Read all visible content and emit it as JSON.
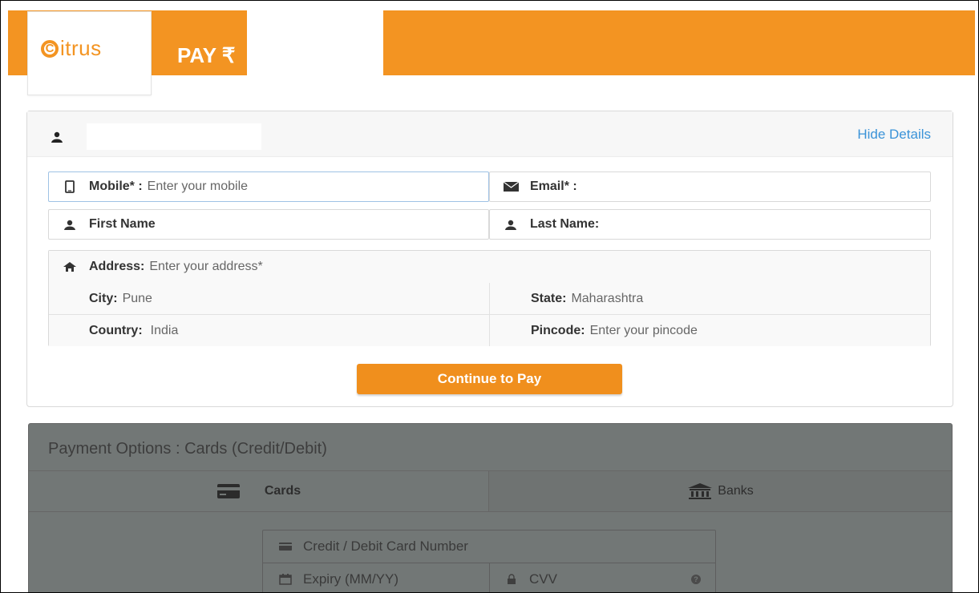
{
  "brand": {
    "logo_letter": "C",
    "logo_text": "itrus",
    "pay_label": "PAY ₹",
    "accent_color": "#f39422"
  },
  "customer": {
    "hide_details": "Hide Details",
    "mobile": {
      "label": "Mobile* :",
      "placeholder": "Enter your mobile"
    },
    "email": {
      "label": "Email* :"
    },
    "first_name": {
      "label": "First Name"
    },
    "last_name": {
      "label": "Last Name:"
    },
    "address": {
      "label": "Address:",
      "placeholder": "Enter your address*"
    },
    "city": {
      "label": "City:",
      "value": "Pune"
    },
    "state": {
      "label": "State:",
      "value": "Maharashtra"
    },
    "country": {
      "label": "Country:",
      "value": "India"
    },
    "pincode": {
      "label": "Pincode:",
      "placeholder": "Enter your pincode"
    },
    "continue_button": "Continue to Pay"
  },
  "payment": {
    "title": "Payment Options : Cards (Credit/Debit)",
    "tabs": [
      {
        "label": "Cards",
        "icon": "card-icon"
      },
      {
        "label": "Banks",
        "icon": "bank-icon"
      }
    ],
    "card_number_placeholder": "Credit / Debit Card Number",
    "expiry_placeholder": "Expiry (MM/YY)",
    "cvv_placeholder": "CVV"
  }
}
